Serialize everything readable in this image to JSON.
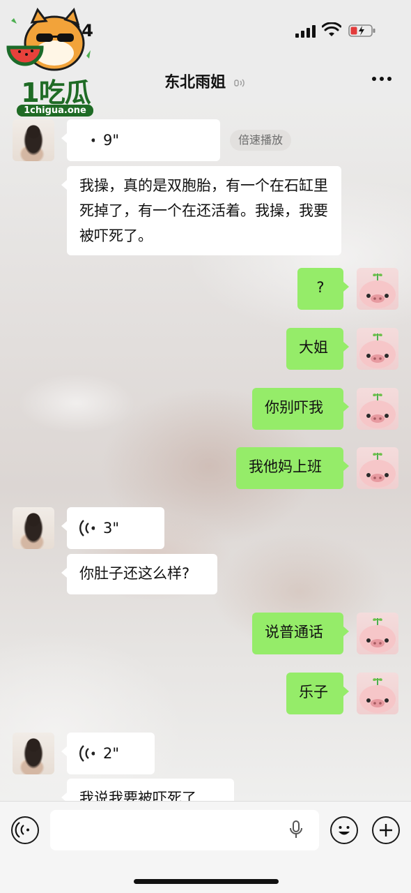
{
  "status_bar": {
    "time": "24"
  },
  "watermark": {
    "brand": "1吃瓜",
    "domain": "1chigua.one"
  },
  "nav": {
    "title": "东北雨姐"
  },
  "messages": [
    {
      "side": "left",
      "type": "voice",
      "duration": "9\""
    },
    {
      "side": "left",
      "type": "text",
      "text": "我操，真的是双胞胎，有一个在石缸里死掉了，有一个在还活着。我操，我要被吓死了。"
    },
    {
      "side": "right",
      "type": "text",
      "text": "?"
    },
    {
      "side": "right",
      "type": "text",
      "text": "大姐"
    },
    {
      "side": "right",
      "type": "text",
      "text": "你别吓我"
    },
    {
      "side": "right",
      "type": "text",
      "text": "我他妈上班"
    },
    {
      "side": "left",
      "type": "voice",
      "duration": "3\""
    },
    {
      "side": "left",
      "type": "text",
      "text": "你肚子还这么样?"
    },
    {
      "side": "right",
      "type": "text",
      "text": "说普通话"
    },
    {
      "side": "right",
      "type": "text",
      "text": "乐子"
    },
    {
      "side": "left",
      "type": "voice",
      "duration": "2\""
    },
    {
      "side": "left",
      "type": "text",
      "text": "我说我要被吓死了"
    }
  ],
  "speed_play": "倍速播放",
  "icons": {
    "voice_toggle": "voice-input-icon",
    "mic": "microphone-icon",
    "emoji": "emoji-icon",
    "plus": "plus-icon"
  },
  "colors": {
    "bubble_sent": "#95ec69",
    "bubble_received": "#ffffff"
  }
}
